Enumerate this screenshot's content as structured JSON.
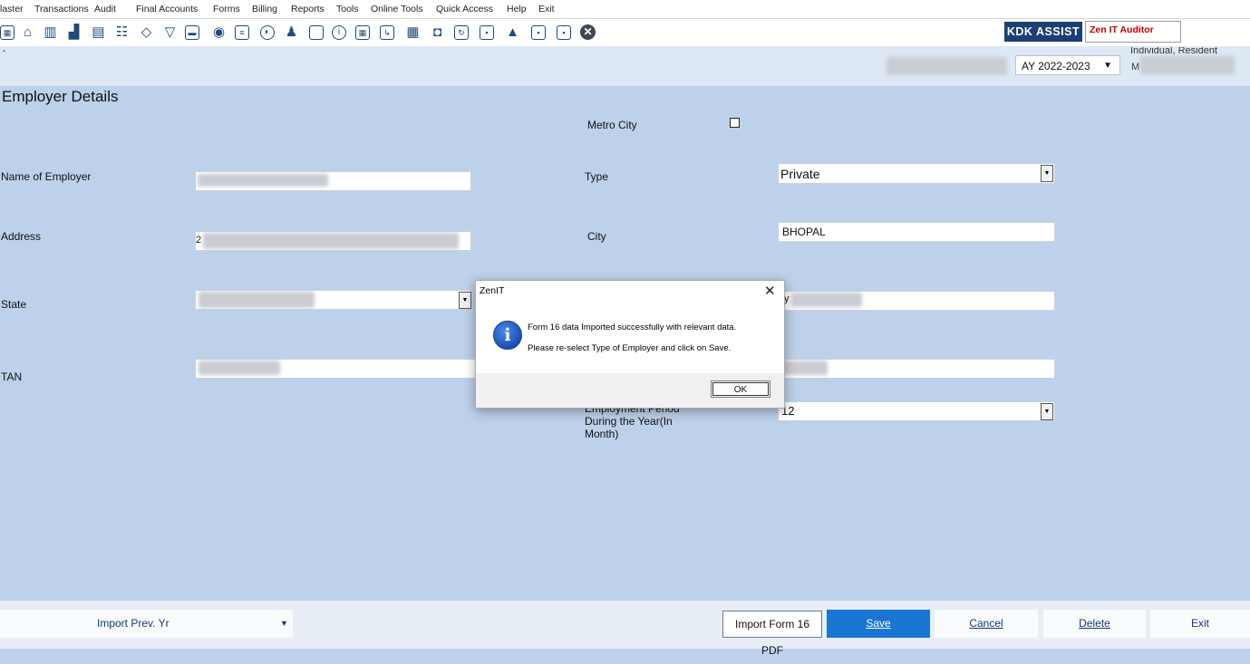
{
  "menu": {
    "items": [
      "laster",
      "Transactions",
      "Audit",
      "Final Accounts",
      "Forms",
      "Billing",
      "Reports",
      "Tools",
      "Online Tools",
      "Quick Access",
      "Help",
      "Exit"
    ]
  },
  "header": {
    "kdk_assist": "KDK ASSIST",
    "zen_auditor": "Zen IT Auditor",
    "assessment_year": "AY 2022-2023",
    "status_line1": "Individual, Resident",
    "status_line2": "M"
  },
  "form": {
    "section_title": "Employer Details",
    "labels": {
      "metro_city": "Metro City",
      "name_of_employer": "Name of Employer",
      "type": "Type",
      "address": "Address",
      "city": "City",
      "state": "State",
      "tan": "TAN",
      "employment_period": "Employment Period During the Year(In Month)"
    },
    "values": {
      "address_prefix": "2",
      "type": "Private",
      "city": "BHOPAL",
      "pin_prefix": "y",
      "employment_period": "12"
    }
  },
  "dialog": {
    "title": "ZenIT",
    "close": "✕",
    "icon_char": "i",
    "line1": "Form 16 data Imported successfully with relevant data.",
    "line2": "Please re-select Type of Employer and click on Save.",
    "ok": "OK"
  },
  "bottom": {
    "import_prev": "Import Prev. Yr",
    "import_prev_arrow": "▼",
    "import_form16": "Import Form 16 PDF",
    "save": "Save",
    "cancel": "Cancel",
    "delete": "Delete",
    "exit": "Exit"
  },
  "colors": {
    "background": "#bdd1ea",
    "save_button": "#1976d2",
    "kdk_assist_bg": "#1e3f73",
    "zen_auditor_text": "#c00000"
  },
  "icons": [
    "calculator-icon",
    "home-icon",
    "grid-icon",
    "bar-chart-icon",
    "building-icon",
    "group-icon",
    "tag-icon",
    "filter-icon",
    "tax-icon",
    "eye-icon",
    "document-icon",
    "pie-icon",
    "pay-icon",
    "clipboard-icon",
    "info-icon",
    "ledger-icon",
    "export-icon",
    "calendar-icon",
    "chat-icon",
    "refresh-icon",
    "bs-icon",
    "stamp-icon",
    "tcd-icon",
    "sheet-icon",
    "close-circle-icon"
  ]
}
